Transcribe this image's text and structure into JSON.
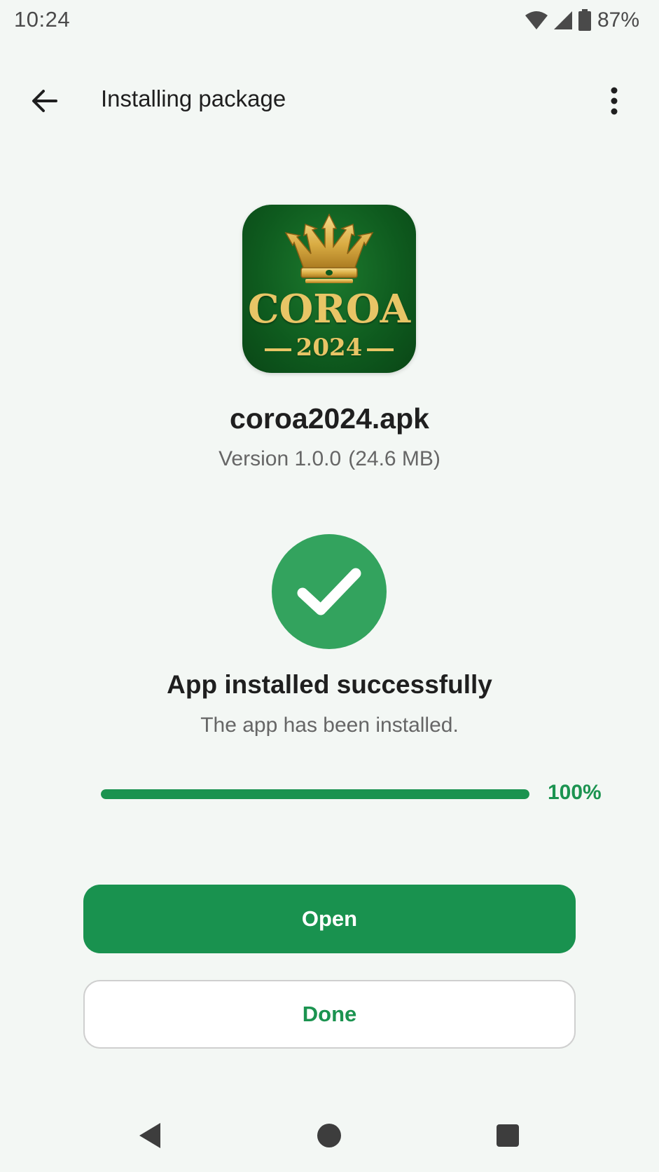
{
  "status_bar": {
    "time": "10:24",
    "battery": "87%",
    "icons": [
      "wifi-icon",
      "signal-icon",
      "battery-icon"
    ]
  },
  "app_bar": {
    "title": "Installing package",
    "back_icon": "arrow-left-icon",
    "menu_icon": "more-vert-icon"
  },
  "app_icon": {
    "word": "COROA",
    "year": "2024",
    "icon": "crown-icon"
  },
  "package": {
    "file_name": "coroa2024.apk",
    "version": "Version 1.0.0",
    "size": "(24.6 MB)"
  },
  "result": {
    "icon": "check-circle-icon",
    "title": "App installed successfully",
    "subtitle": "The app has been installed."
  },
  "progress": {
    "value": 1.0,
    "label": "100%"
  },
  "actions": {
    "open_label": "Open",
    "done_label": "Done"
  },
  "navigation": {
    "back_icon": "nav-back-icon",
    "home_icon": "nav-home-icon",
    "recents_icon": "nav-recents-icon"
  },
  "colors": {
    "background": "#f3f7f4",
    "accent": "#19924f",
    "success": "#33a35e",
    "icon_green": "#0e5a1e",
    "icon_gold": "#e8c566"
  }
}
